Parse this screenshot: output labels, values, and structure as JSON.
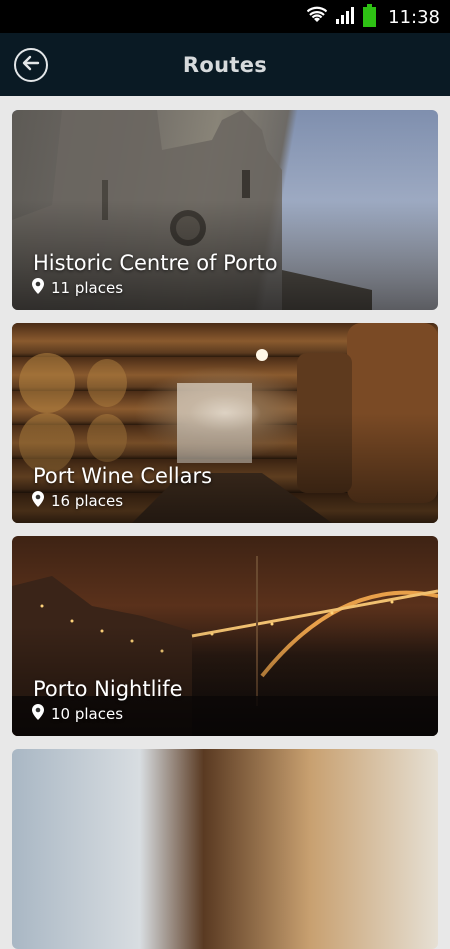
{
  "status_bar": {
    "time": "11:38",
    "icons": [
      "wifi-icon",
      "signal-icon",
      "battery-icon"
    ],
    "battery_color": "#2ec214"
  },
  "app_bar": {
    "title": "Routes",
    "back_icon": "back-arrow-icon",
    "background": "#0a1a24"
  },
  "routes": [
    {
      "title": "Historic Centre of Porto",
      "places": "11 places",
      "image": "porto-cathedral"
    },
    {
      "title": "Port Wine Cellars",
      "places": "16 places",
      "image": "wine-barrels"
    },
    {
      "title": "Porto Nightlife",
      "places": "10 places",
      "image": "bridge-at-night"
    },
    {
      "title": "",
      "places": "",
      "image": "interior-partial"
    }
  ]
}
